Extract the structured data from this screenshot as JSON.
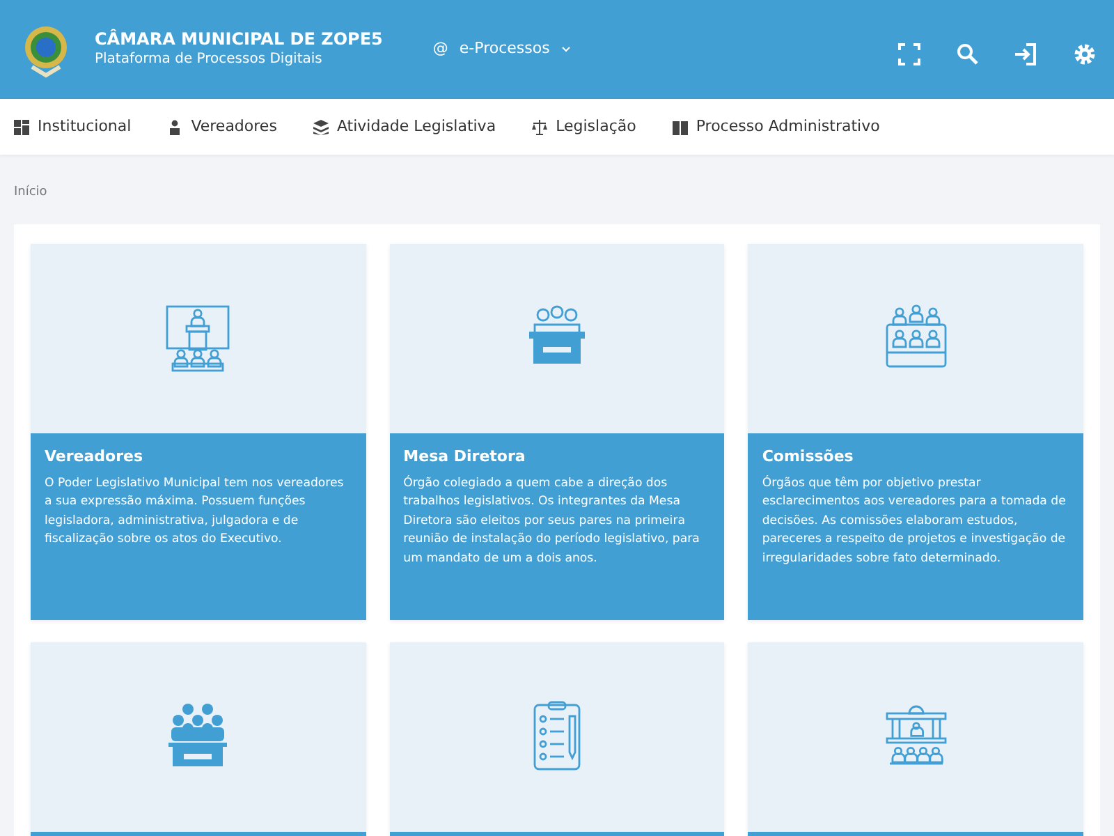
{
  "header": {
    "title": "CÂMARA MUNICIPAL DE ZOPE5",
    "subtitle": "Plataforma de Processos Digitais",
    "menu": {
      "symbol": "@",
      "label": "e-Processos"
    }
  },
  "nav": [
    {
      "label": "Institucional"
    },
    {
      "label": "Vereadores"
    },
    {
      "label": "Atividade Legislativa"
    },
    {
      "label": "Legislação"
    },
    {
      "label": "Processo Administrativo"
    }
  ],
  "breadcrumb": "Início",
  "cards": [
    {
      "title": "Vereadores",
      "text": "O Poder Legislativo Municipal tem nos vereadores a sua expressão máxima. Possuem funções legisladora, administrativa, julgadora e de fiscalização sobre os atos do Executivo."
    },
    {
      "title": "Mesa Diretora",
      "text": "Órgão colegiado a quem cabe a direção dos trabalhos legislativos. Os integrantes da Mesa Diretora são eleitos por seus pares na primeira reunião de instalação do período legislativo, para um mandato de um a dois anos."
    },
    {
      "title": "Comissões",
      "text": "Órgãos que têm por objetivo prestar esclarecimentos aos vereadores para a tomada de decisões. As comissões elaboram estudos, pareceres a respeito de projetos e investigação de irregularidades sobre fato determinado."
    }
  ]
}
